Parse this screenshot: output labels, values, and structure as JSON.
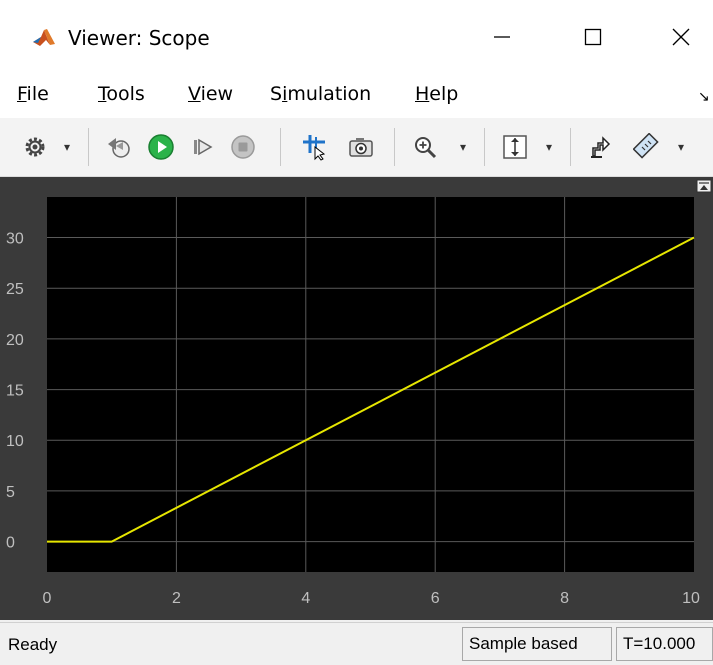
{
  "window": {
    "title": "Viewer: Scope",
    "icon": "matlab-logo-icon"
  },
  "menu": {
    "items": [
      {
        "label_first": "F",
        "label_rest": "ile"
      },
      {
        "label_first": "T",
        "label_rest": "ools"
      },
      {
        "label_first": "V",
        "label_rest": "iew"
      },
      {
        "label_pre": "S",
        "label_first": "i",
        "label_rest": "mulation"
      },
      {
        "label_first": "H",
        "label_rest": "elp"
      }
    ]
  },
  "toolbar": {
    "icons": [
      "settings-gear-icon",
      "step-back-icon",
      "run-icon",
      "step-forward-icon",
      "stop-icon",
      "cursor-measure-icon",
      "snapshot-camera-icon",
      "zoom-in-icon",
      "autoscale-icon",
      "highlight-block-icon",
      "measurements-icon"
    ]
  },
  "chart_data": {
    "type": "line",
    "xlim": [
      0,
      10
    ],
    "ylim": [
      -3,
      34
    ],
    "xticks": [
      "0",
      "2",
      "4",
      "6",
      "8",
      "10"
    ],
    "yticks": [
      "0",
      "5",
      "10",
      "15",
      "20",
      "25",
      "30"
    ],
    "grid": true,
    "series": [
      {
        "color": "#e6e600",
        "x": [
          0,
          1,
          10
        ],
        "y": [
          0,
          0,
          30
        ]
      }
    ],
    "background": "#000000",
    "axes_background": "#3a3a3a",
    "grid_color": "#5a5a5a"
  },
  "status": {
    "left": "Ready",
    "mode": "Sample based",
    "time": "T=10.000"
  }
}
